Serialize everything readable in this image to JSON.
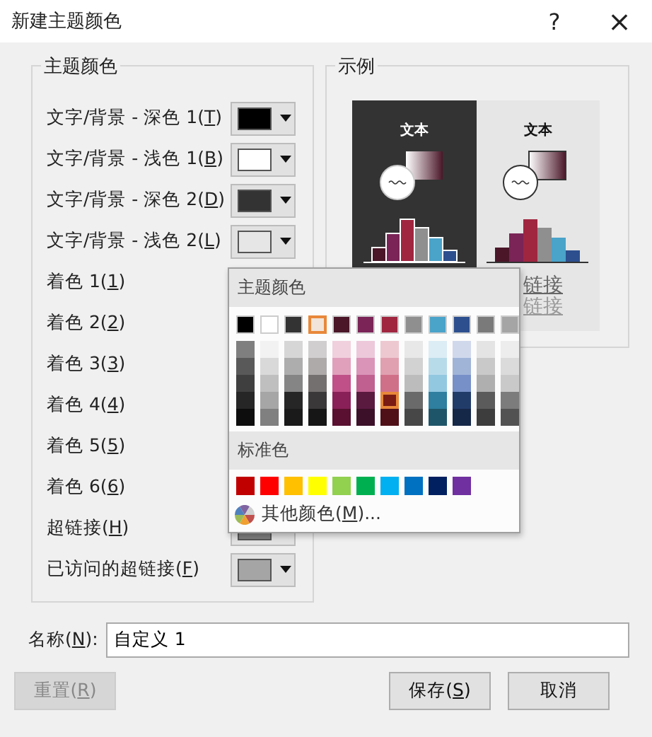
{
  "window": {
    "title": "新建主题颜色",
    "help": "?",
    "close": "×"
  },
  "theme_colors": {
    "legend": "主题颜色",
    "rows": [
      {
        "label": "文字/背景 - 深色 1(T)",
        "color": "#000000"
      },
      {
        "label": "文字/背景 - 浅色 1(B)",
        "color": "#ffffff"
      },
      {
        "label": "文字/背景 - 深色 2(D)",
        "color": "#333333"
      },
      {
        "label": "文字/背景 - 浅色 2(L)",
        "color": "#e7e6e6"
      },
      {
        "label": "着色 1(1)"
      },
      {
        "label": "着色 2(2)"
      },
      {
        "label": "着色 3(3)"
      },
      {
        "label": "着色 4(4)"
      },
      {
        "label": "着色 5(5)"
      },
      {
        "label": "着色 6(6)"
      },
      {
        "label": "超链接(H)",
        "color": "#7f7f7f"
      },
      {
        "label": "已访问的超链接(F)",
        "color": "#a5a5a5"
      }
    ]
  },
  "sample": {
    "legend": "示例",
    "dark_text": "文本",
    "light_text": "文本",
    "hyperlink": "链接",
    "visited_hyperlink": "链接"
  },
  "color_popup": {
    "theme_heading": "主题颜色",
    "columns": [
      {
        "color": "#000000",
        "selected": false,
        "shades": [
          {
            "color": "#7f7f7f",
            "selected": false
          },
          {
            "color": "#595959",
            "selected": false
          },
          {
            "color": "#3f3f3f",
            "selected": false
          },
          {
            "color": "#262626",
            "selected": false
          },
          {
            "color": "#0d0d0d",
            "selected": false
          }
        ]
      },
      {
        "color": "#ffffff",
        "selected": false,
        "shades": [
          {
            "color": "#f2f2f2",
            "selected": false
          },
          {
            "color": "#d9d9d9",
            "selected": false
          },
          {
            "color": "#bfbfbf",
            "selected": false
          },
          {
            "color": "#a6a6a6",
            "selected": false
          },
          {
            "color": "#808080",
            "selected": false
          }
        ]
      },
      {
        "color": "#333333",
        "selected": false,
        "shades": [
          {
            "color": "#d6d6d6",
            "selected": false
          },
          {
            "color": "#adadad",
            "selected": false
          },
          {
            "color": "#858585",
            "selected": false
          },
          {
            "color": "#262626",
            "selected": false
          },
          {
            "color": "#1a1a1a",
            "selected": false
          }
        ]
      },
      {
        "color": "#f2e4d8",
        "selected": true,
        "shades": [
          {
            "color": "#d0cece",
            "selected": false
          },
          {
            "color": "#aeaaaa",
            "selected": false
          },
          {
            "color": "#757070",
            "selected": false
          },
          {
            "color": "#3a3838",
            "selected": false
          },
          {
            "color": "#171616",
            "selected": false
          }
        ]
      },
      {
        "color": "#4a1628",
        "selected": false,
        "shades": [
          {
            "color": "#f0d0dc",
            "selected": false
          },
          {
            "color": "#e0a0bc",
            "selected": false
          },
          {
            "color": "#c05088",
            "selected": false
          },
          {
            "color": "#8a2058",
            "selected": false
          },
          {
            "color": "#5a1030",
            "selected": false
          }
        ]
      },
      {
        "color": "#7a2457",
        "selected": false,
        "shades": [
          {
            "color": "#ecc8da",
            "selected": false
          },
          {
            "color": "#da94b8",
            "selected": false
          },
          {
            "color": "#c06090",
            "selected": false
          },
          {
            "color": "#5a1a40",
            "selected": false
          },
          {
            "color": "#3c1028",
            "selected": false
          }
        ]
      },
      {
        "color": "#a02640",
        "selected": false,
        "shades": [
          {
            "color": "#eec8d0",
            "selected": false
          },
          {
            "color": "#e0a0b0",
            "selected": false
          },
          {
            "color": "#d07088",
            "selected": false
          },
          {
            "color": "#7a1c14",
            "selected": true
          },
          {
            "color": "#501018",
            "selected": false
          }
        ]
      },
      {
        "color": "#8f8f8f",
        "selected": false,
        "shades": [
          {
            "color": "#e8e8e8",
            "selected": false
          },
          {
            "color": "#d2d2d2",
            "selected": false
          },
          {
            "color": "#bcbcbc",
            "selected": false
          },
          {
            "color": "#6a6a6a",
            "selected": false
          },
          {
            "color": "#474747",
            "selected": false
          }
        ]
      },
      {
        "color": "#4aa3c9",
        "selected": false,
        "shades": [
          {
            "color": "#dcedf5",
            "selected": false
          },
          {
            "color": "#b8dbea",
            "selected": false
          },
          {
            "color": "#92c8e0",
            "selected": false
          },
          {
            "color": "#2e7fa0",
            "selected": false
          },
          {
            "color": "#1f5568",
            "selected": false
          }
        ]
      },
      {
        "color": "#2d4f8e",
        "selected": false,
        "shades": [
          {
            "color": "#d0d8ec",
            "selected": false
          },
          {
            "color": "#a0b4d8",
            "selected": false
          },
          {
            "color": "#7890c8",
            "selected": false
          },
          {
            "color": "#223c6a",
            "selected": false
          },
          {
            "color": "#162848",
            "selected": false
          }
        ]
      },
      {
        "color": "#7a7a7a",
        "selected": false,
        "shades": [
          {
            "color": "#e4e4e4",
            "selected": false
          },
          {
            "color": "#c9c9c9",
            "selected": false
          },
          {
            "color": "#afafaf",
            "selected": false
          },
          {
            "color": "#5b5b5b",
            "selected": false
          },
          {
            "color": "#3d3d3d",
            "selected": false
          }
        ]
      },
      {
        "color": "#a5a5a5",
        "selected": false,
        "shades": [
          {
            "color": "#ededed",
            "selected": false
          },
          {
            "color": "#dbdbdb",
            "selected": false
          },
          {
            "color": "#c9c9c9",
            "selected": false
          },
          {
            "color": "#7c7c7c",
            "selected": false
          },
          {
            "color": "#525252",
            "selected": false
          }
        ]
      }
    ],
    "standard_heading": "标准色",
    "standard_colors": [
      {
        "color": "#c00000"
      },
      {
        "color": "#ff0000"
      },
      {
        "color": "#ffc000"
      },
      {
        "color": "#ffff00"
      },
      {
        "color": "#92d050"
      },
      {
        "color": "#00b050"
      },
      {
        "color": "#00b0f0"
      },
      {
        "color": "#0070c0"
      },
      {
        "color": "#002060"
      },
      {
        "color": "#7030a0"
      }
    ],
    "more_colors": "其他颜色(M)..."
  },
  "name_field": {
    "label": "名称(N):",
    "value": "自定义 1"
  },
  "buttons": [
    {
      "label": "重置(R)",
      "disabled": true
    },
    {
      "label": "保存(S)",
      "disabled": false
    },
    {
      "label": "取消",
      "disabled": false
    }
  ]
}
